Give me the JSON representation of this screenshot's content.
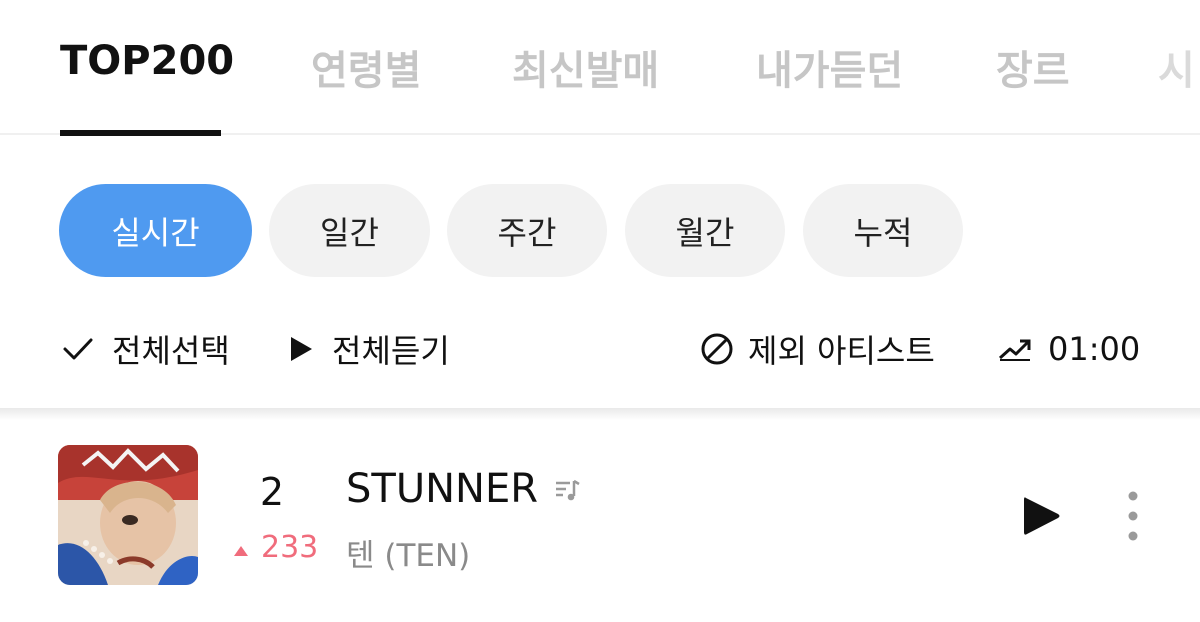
{
  "tabs": [
    {
      "label": "TOP200",
      "active": true
    },
    {
      "label": "연령별",
      "active": false
    },
    {
      "label": "최신발매",
      "active": false
    },
    {
      "label": "내가듣던",
      "active": false
    },
    {
      "label": "장르",
      "active": false
    },
    {
      "label": "시",
      "active": false
    }
  ],
  "periods": [
    {
      "label": "실시간",
      "active": true
    },
    {
      "label": "일간",
      "active": false
    },
    {
      "label": "주간",
      "active": false
    },
    {
      "label": "월간",
      "active": false
    },
    {
      "label": "누적",
      "active": false
    }
  ],
  "actions": {
    "select_all": "전체선택",
    "play_all": "전체듣기",
    "exclude_artist": "제외 아티스트",
    "chart_time": "01:00"
  },
  "song": {
    "rank": "2",
    "rank_change": "233",
    "rank_direction": "up",
    "title": "STUNNER",
    "artist": "텐 (TEN)"
  },
  "colors": {
    "accent": "#4f9af0",
    "rank_up": "#f06c7c",
    "inactive_tab": "#c6c6c6"
  }
}
